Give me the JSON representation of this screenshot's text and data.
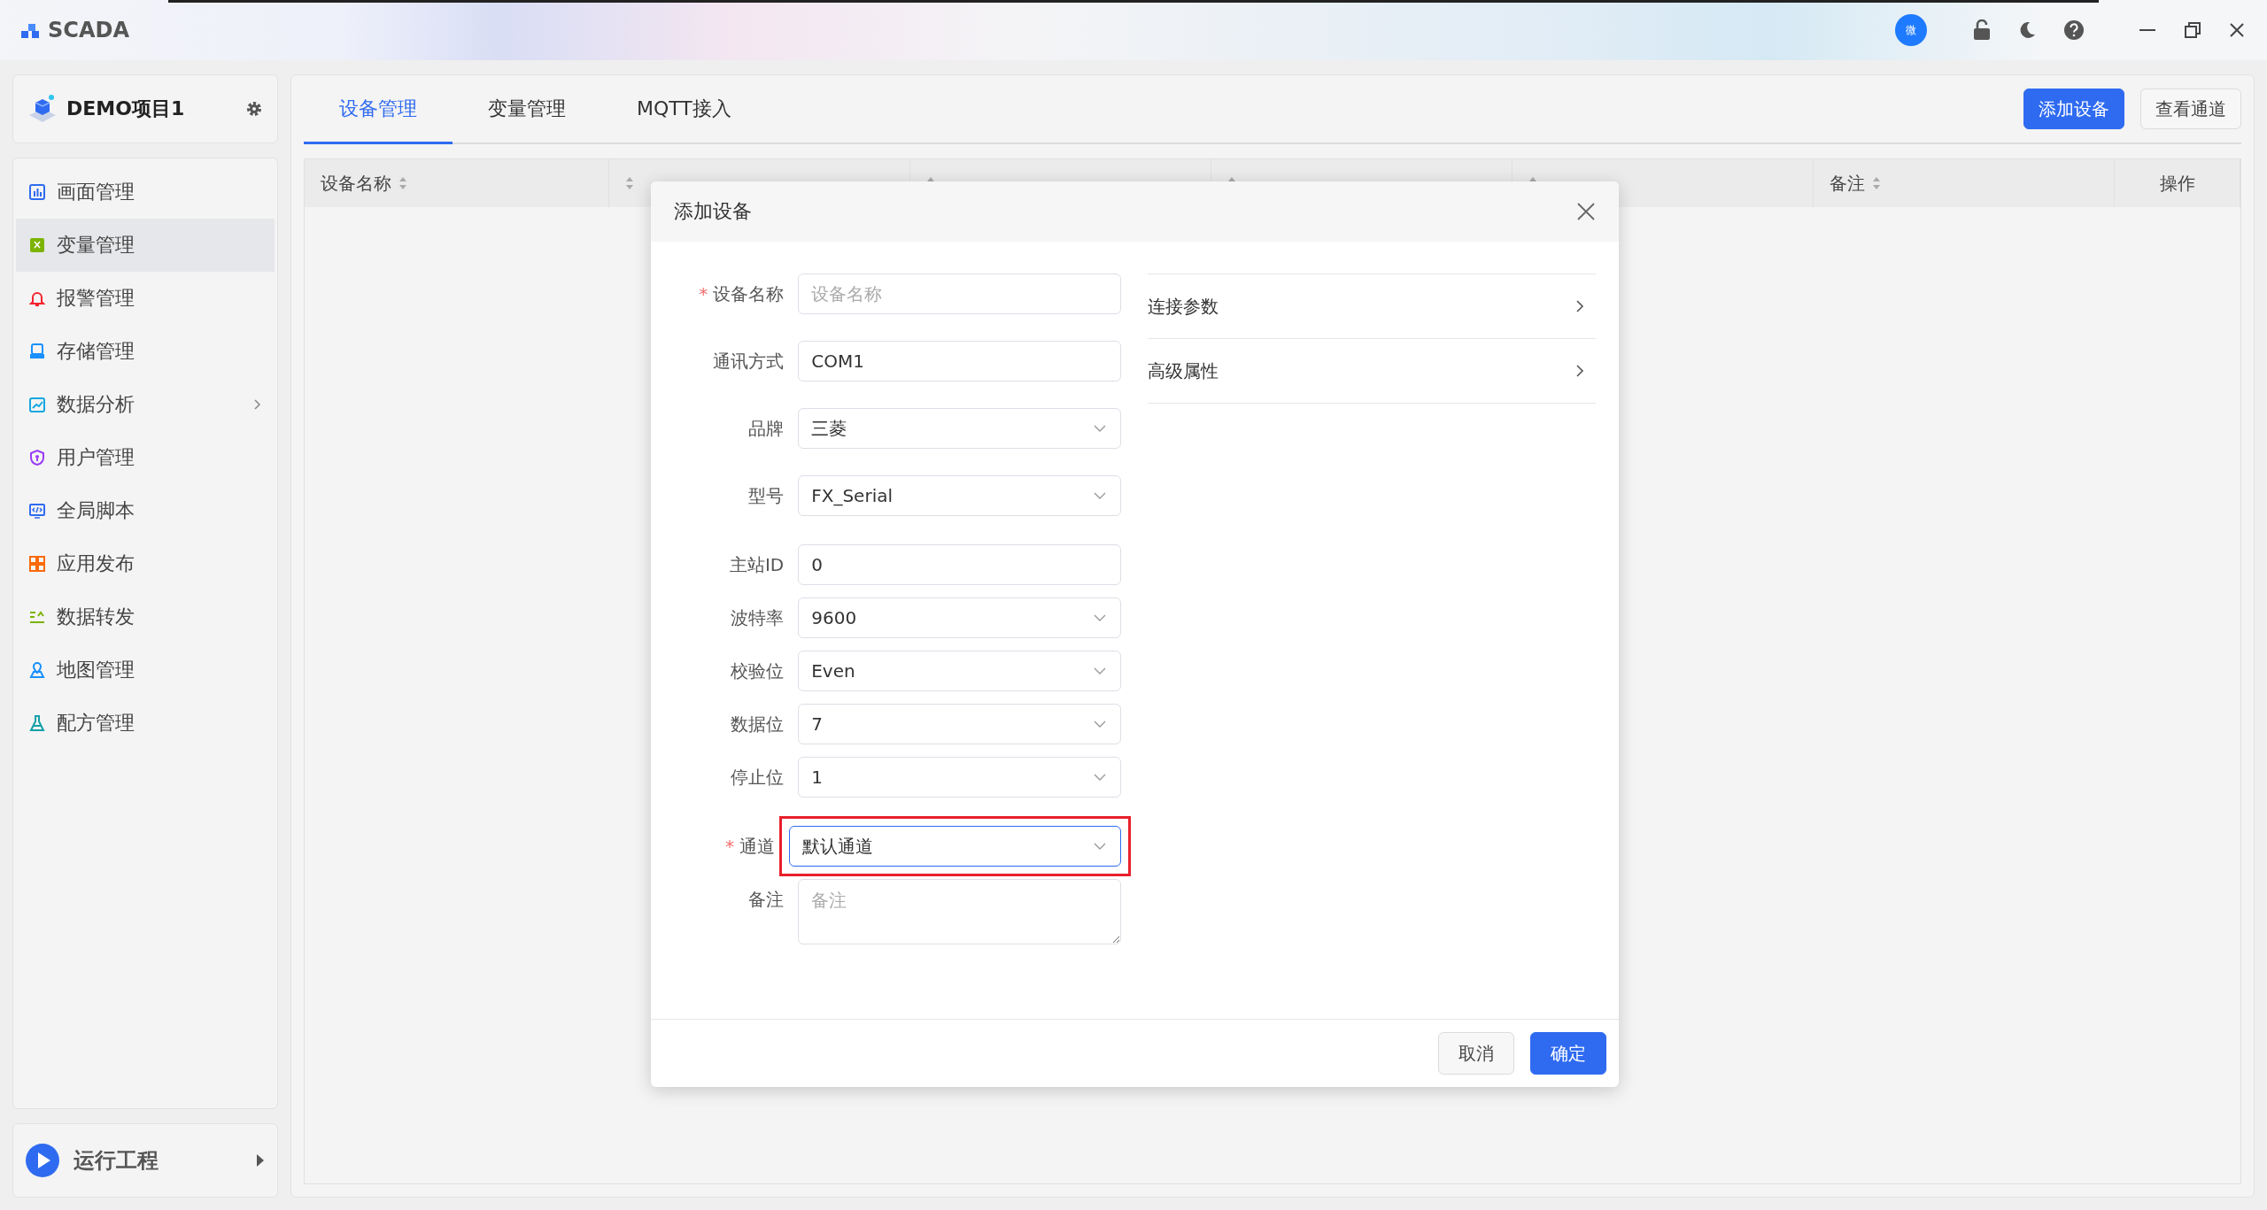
{
  "app": {
    "title": "SCADA",
    "user_badge": "微"
  },
  "project": {
    "name": "DEMO项目1"
  },
  "sidebar": {
    "items": [
      {
        "label": "画面管理",
        "selected": false,
        "has_submenu": false
      },
      {
        "label": "变量管理",
        "selected": true,
        "has_submenu": false
      },
      {
        "label": "报警管理",
        "selected": false,
        "has_submenu": false
      },
      {
        "label": "存储管理",
        "selected": false,
        "has_submenu": false
      },
      {
        "label": "数据分析",
        "selected": false,
        "has_submenu": true
      },
      {
        "label": "用户管理",
        "selected": false,
        "has_submenu": false
      },
      {
        "label": "全局脚本",
        "selected": false,
        "has_submenu": false
      },
      {
        "label": "应用发布",
        "selected": false,
        "has_submenu": false
      },
      {
        "label": "数据转发",
        "selected": false,
        "has_submenu": false
      },
      {
        "label": "地图管理",
        "selected": false,
        "has_submenu": false
      },
      {
        "label": "配方管理",
        "selected": false,
        "has_submenu": false
      }
    ]
  },
  "run_button": {
    "label": "运行工程"
  },
  "tabs": [
    {
      "label": "设备管理",
      "selected": true
    },
    {
      "label": "变量管理",
      "selected": false
    },
    {
      "label": "MQTT接入",
      "selected": false
    }
  ],
  "actions": [
    {
      "label": "添加设备",
      "kind": "primary"
    },
    {
      "label": "查看通道",
      "kind": "default"
    }
  ],
  "table": {
    "columns": [
      {
        "label": "设备名称",
        "sortable": true
      },
      {
        "sortable": true
      },
      {
        "sortable": true
      },
      {
        "sortable": true
      },
      {
        "sortable": true
      },
      {
        "label": "备注",
        "sortable": true
      },
      {
        "label": "操作",
        "sortable": false
      }
    ]
  },
  "dialog": {
    "title": "添加设备",
    "fields": [
      {
        "label": "设备名称",
        "kind": "input",
        "required_mark": "*",
        "placeholder": "设备名称"
      },
      {
        "label": "通讯方式",
        "kind": "input",
        "value": "COM1"
      },
      {
        "label": "品牌",
        "kind": "select",
        "value": "三菱"
      },
      {
        "label": "型号",
        "kind": "select",
        "value": "FX_Serial"
      },
      {
        "label": "主站ID",
        "kind": "input",
        "value": "0"
      },
      {
        "label": "波特率",
        "kind": "select",
        "value": "9600"
      },
      {
        "label": "校验位",
        "kind": "select",
        "value": "Even"
      },
      {
        "label": "数据位",
        "kind": "select",
        "value": "7"
      },
      {
        "label": "停止位",
        "kind": "select",
        "value": "1"
      },
      {
        "label": "通道",
        "kind": "select",
        "required_mark": "*",
        "value": "默认通道",
        "focused": true,
        "highlighted": true
      },
      {
        "label": "备注",
        "kind": "textarea",
        "placeholder": "备注"
      }
    ],
    "sections": [
      {
        "label": "连接参数",
        "expanded": false
      },
      {
        "label": "高级属性",
        "expanded": false
      }
    ],
    "buttons": [
      {
        "label": "取消",
        "kind": "default"
      },
      {
        "label": "确定",
        "kind": "primary"
      }
    ]
  }
}
